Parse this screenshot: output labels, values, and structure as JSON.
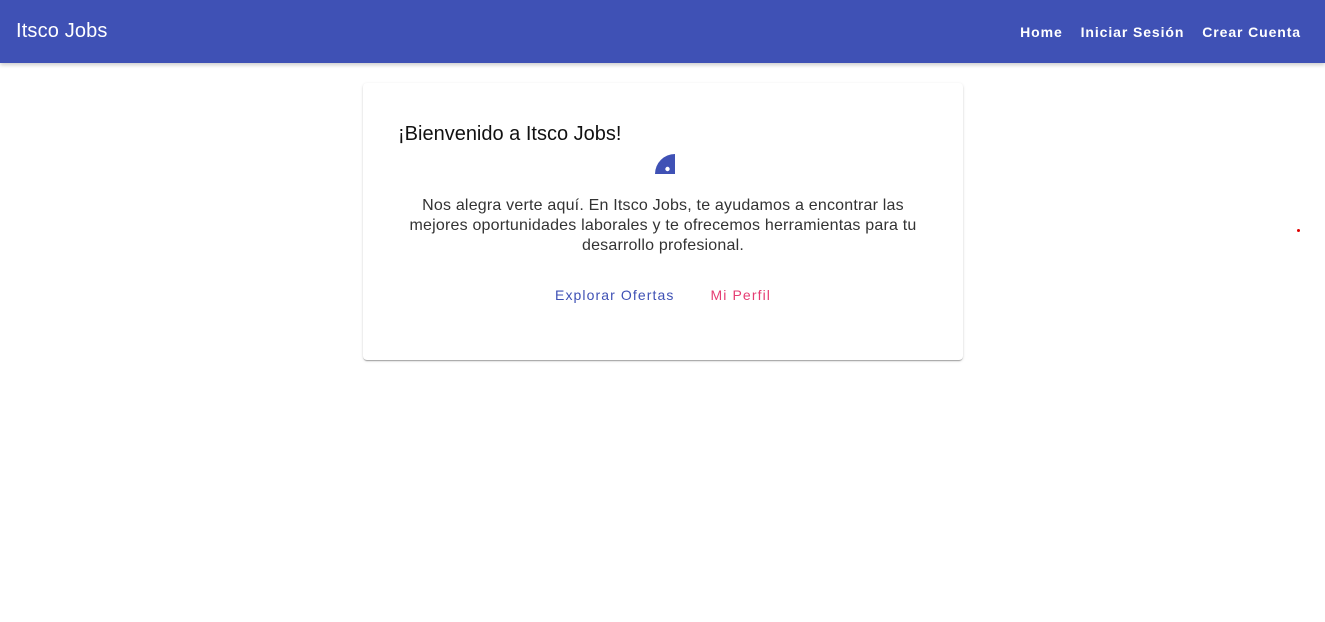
{
  "app": {
    "title": "Itsco Jobs"
  },
  "nav": {
    "home": "Home",
    "login": "Iniciar Sesión",
    "register": "Crear Cuenta"
  },
  "welcome": {
    "title": "¡Bienvenido a Itsco Jobs!",
    "message": "Nos alegra verte aquí. En Itsco Jobs, te ayudamos a encontrar las mejores oportunidades laborales y te ofrecemos herramientas para tu desarrollo profesional.",
    "explore_label": "Explorar Ofertas",
    "profile_label": "Mi Perfil",
    "icon": "loading-spinner-icon"
  },
  "colors": {
    "primary": "#3f51b5",
    "secondary": "#e53d73",
    "indicator": "#e00000"
  }
}
